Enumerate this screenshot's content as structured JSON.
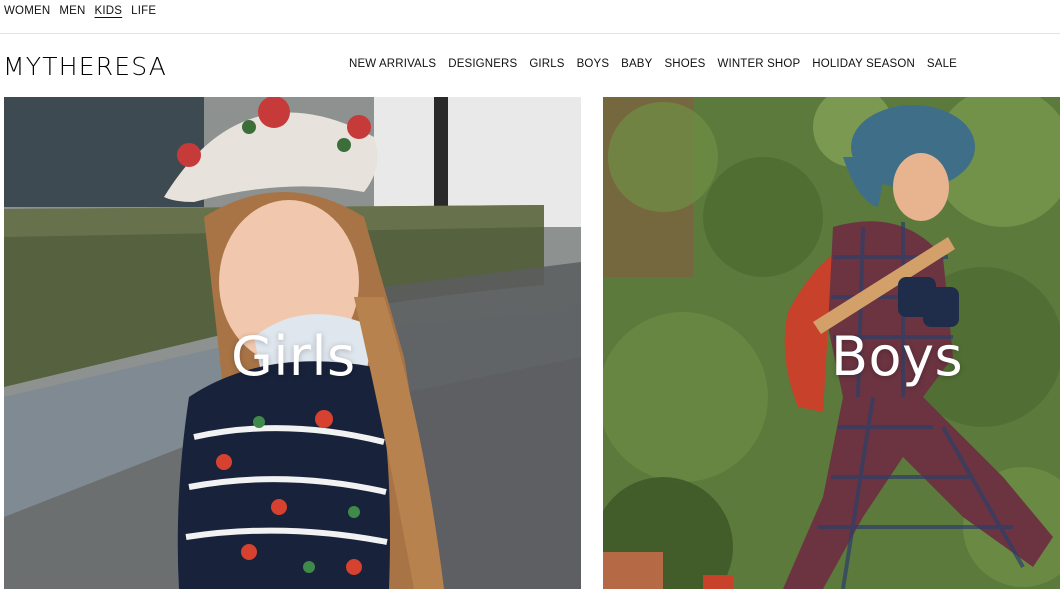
{
  "top_nav": {
    "items": [
      {
        "label": "WOMEN"
      },
      {
        "label": "MEN"
      },
      {
        "label": "KIDS"
      },
      {
        "label": "LIFE"
      }
    ]
  },
  "header": {
    "logo": "MYTHERESA",
    "nav": [
      {
        "label": "NEW ARRIVALS"
      },
      {
        "label": "DESIGNERS"
      },
      {
        "label": "GIRLS"
      },
      {
        "label": "BOYS"
      },
      {
        "label": "BABY"
      },
      {
        "label": "SHOES"
      },
      {
        "label": "WINTER SHOP"
      },
      {
        "label": "HOLIDAY SEASON"
      },
      {
        "label": "SALE"
      }
    ]
  },
  "tiles": {
    "girls": {
      "label": "Girls"
    },
    "boys": {
      "label": "Boys"
    }
  }
}
